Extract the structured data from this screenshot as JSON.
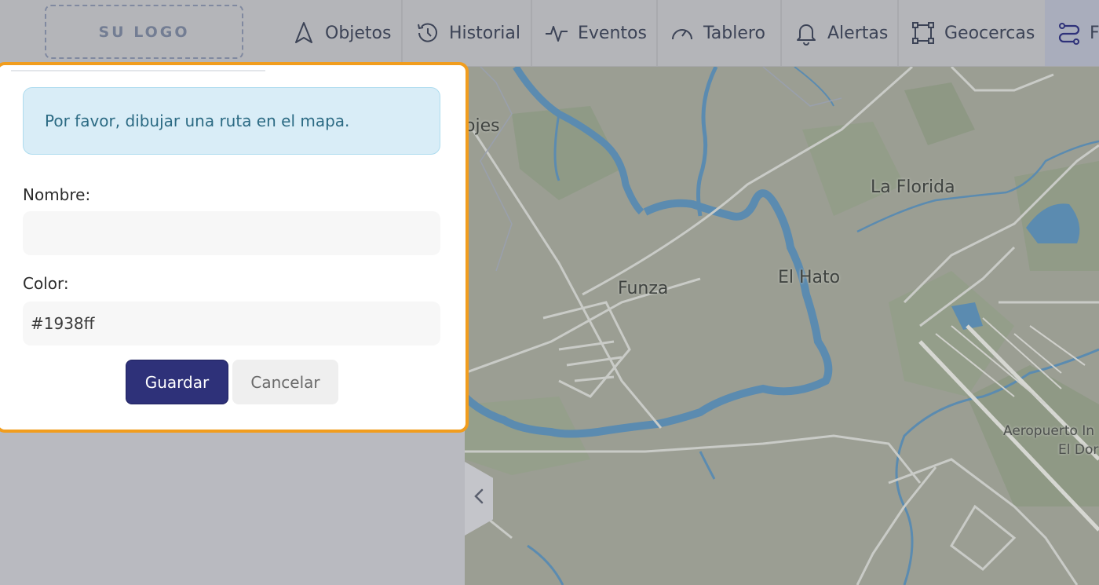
{
  "header": {
    "logo": "SU LOGO",
    "tabs": [
      {
        "label": "Objetos",
        "icon": "navigation-arrow-icon"
      },
      {
        "label": "Historial",
        "icon": "history-icon"
      },
      {
        "label": "Eventos",
        "icon": "activity-icon"
      },
      {
        "label": "Tablero",
        "icon": "gauge-icon"
      },
      {
        "label": "Alertas",
        "icon": "bell-icon"
      },
      {
        "label": "Geocercas",
        "icon": "geofence-icon"
      },
      {
        "label": "F",
        "icon": "route-icon"
      }
    ]
  },
  "panel": {
    "alert": "Por favor, dibujar una ruta en el mapa.",
    "name_label": "Nombre:",
    "name_value": "",
    "color_label": "Color:",
    "color_value": "#1938ff",
    "save": "Guardar",
    "cancel": "Cancelar"
  },
  "map": {
    "labels": [
      "ojes",
      "La Florida",
      "El Hato",
      "Funza",
      "Aeropuerto In",
      "El Dor"
    ]
  },
  "colors": {
    "highlight": "#f19d1e",
    "primary_button": "#2e3179",
    "water": "#5b8bb0",
    "map_base": "#9b9e93"
  }
}
